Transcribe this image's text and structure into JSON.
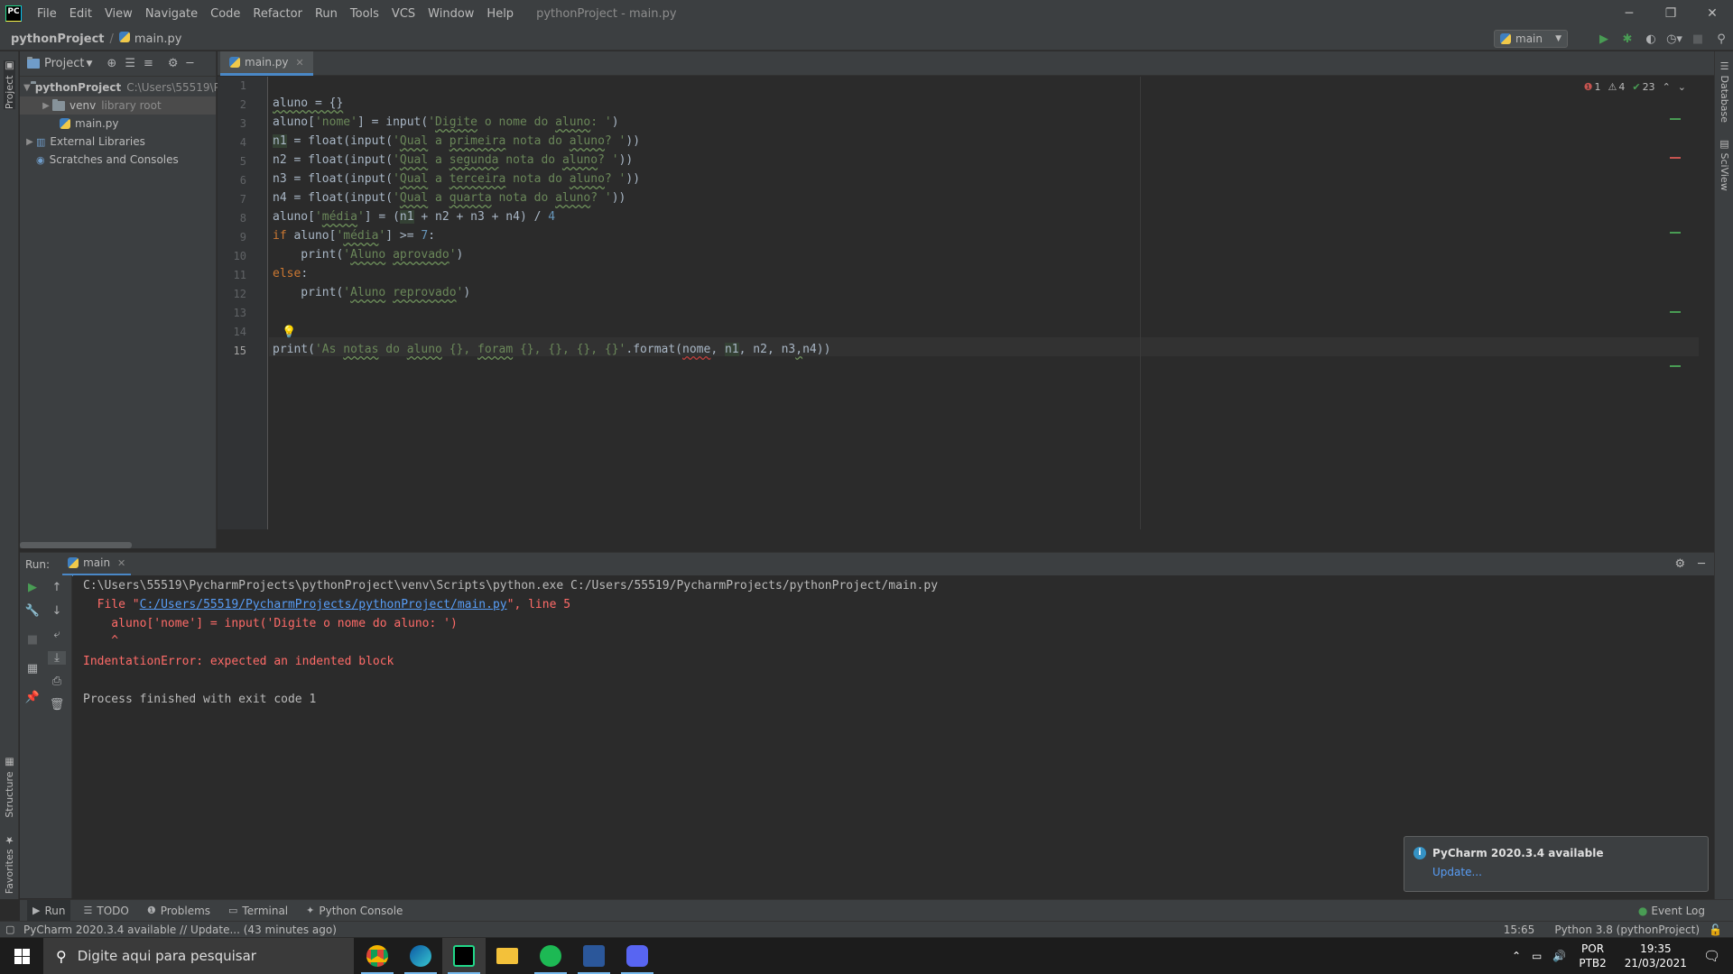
{
  "window": {
    "title": "pythonProject - main.py",
    "menu": [
      "File",
      "Edit",
      "View",
      "Navigate",
      "Code",
      "Refactor",
      "Run",
      "Tools",
      "VCS",
      "Window",
      "Help"
    ],
    "logo_text": "PC"
  },
  "navbar": {
    "project": "pythonProject",
    "file": "main.py",
    "run_config": "main"
  },
  "project_panel": {
    "title": "Project",
    "tree": [
      {
        "label": "pythonProject",
        "hint": "C:\\Users\\55519\\P"
      },
      {
        "label": "venv",
        "hint": "library root"
      },
      {
        "label": "main.py"
      },
      {
        "label": "External Libraries"
      },
      {
        "label": "Scratches and Consoles"
      }
    ]
  },
  "left_stripe": {
    "project": "Project",
    "structure": "Structure",
    "favorites": "Favorites"
  },
  "right_stripe": {
    "database": "Database",
    "sciview": "SciView"
  },
  "editor": {
    "tab": "main.py",
    "line_numbers": [
      "1",
      "2",
      "3",
      "4",
      "5",
      "6",
      "7",
      "8",
      "9",
      "10",
      "11",
      "12",
      "13",
      "14",
      "15"
    ],
    "inspection": {
      "errors": "1",
      "warnings": "4",
      "typos": "23"
    }
  },
  "run": {
    "label": "Run:",
    "tab": "main",
    "output": {
      "cmd": "C:\\Users\\55519\\PycharmProjects\\pythonProject\\venv\\Scripts\\python.exe C:/Users/55519/PycharmProjects/pythonProject/main.py",
      "file_prefix": "  File \"",
      "file_link": "C:/Users/55519/PycharmProjects/pythonProject/main.py",
      "file_suffix": "\", line 5",
      "src": "    aluno['nome'] = input('Digite o nome do aluno: ')",
      "caret": "    ^",
      "error": "IndentationError: expected an indented block",
      "finished": "Process finished with exit code 1"
    }
  },
  "notification": {
    "title": "PyCharm 2020.3.4 available",
    "link": "Update..."
  },
  "bottom_tools": [
    "Run",
    "TODO",
    "Problems",
    "Terminal",
    "Python Console"
  ],
  "event_log": "Event Log",
  "status": {
    "message": "PyCharm 2020.3.4 available // Update... (43 minutes ago)",
    "position": "15:65",
    "interpreter": "Python 3.8 (pythonProject)"
  },
  "taskbar": {
    "search_placeholder": "Digite aqui para pesquisar",
    "lang1": "POR",
    "lang2": "PTB2",
    "time": "19:35",
    "date": "21/03/2021"
  }
}
